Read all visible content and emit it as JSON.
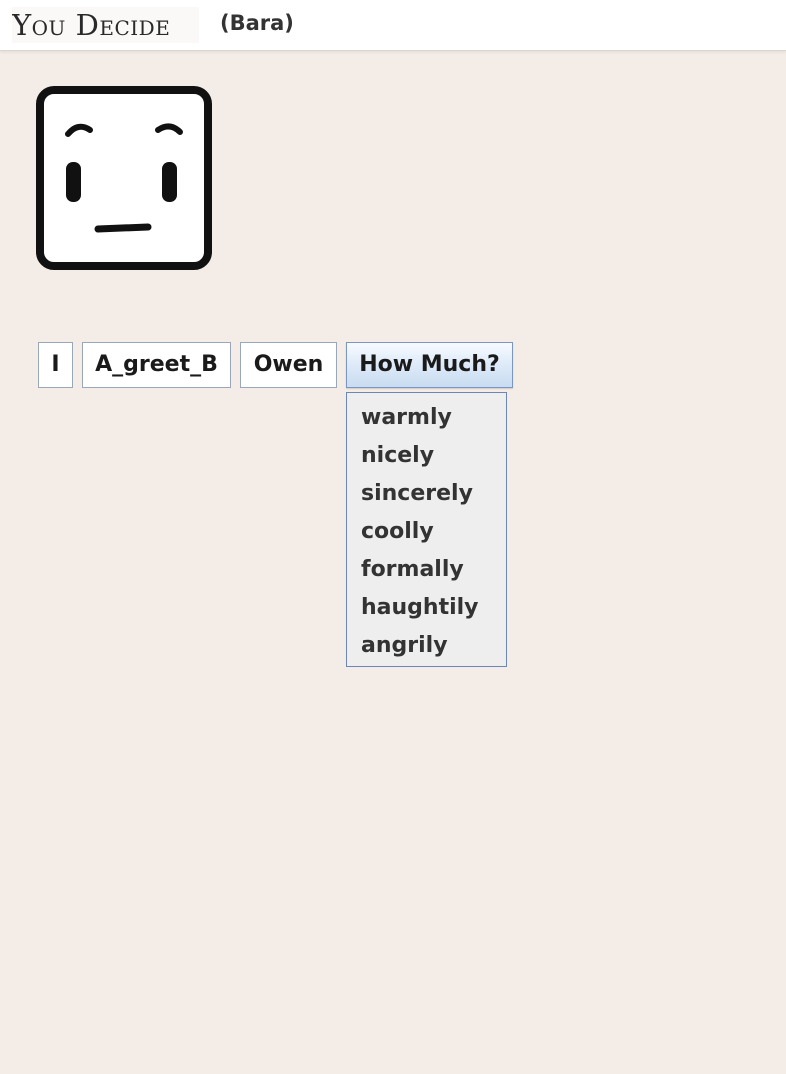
{
  "header": {
    "title": "You Decide",
    "player": "(Bara)"
  },
  "avatar": {
    "icon": "blank-face-icon"
  },
  "sentence": {
    "words": [
      "I",
      "A_greet_B",
      "Owen"
    ],
    "prompt": "How Much?"
  },
  "menu": {
    "options": [
      "warmly",
      "nicely",
      "sincerely",
      "coolly",
      "formally",
      "haughtily",
      "angrily"
    ]
  }
}
